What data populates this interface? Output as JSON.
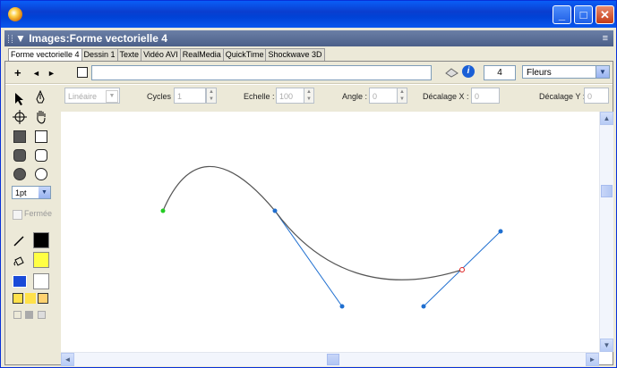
{
  "window": {
    "title": "",
    "minimize": "_",
    "maximize": "□",
    "close": "✕"
  },
  "panel": {
    "title": "▼ Images:Forme vectorielle 4",
    "menu_icon": "≡"
  },
  "tabs": [
    "Forme vectorielle 4",
    "Dessin 1",
    "Texte",
    "Vidéo AVI",
    "RealMedia",
    "QuickTime",
    "Shockwave 3D"
  ],
  "toolbar": {
    "add": "+",
    "prev": "◄",
    "next": "►",
    "name_value": "",
    "number_value": "4",
    "category_value": "Fleurs",
    "category_arrow": "▼"
  },
  "props": {
    "gradient_value": "Linéaire",
    "cycles_label": "Cycles :",
    "cycles_value": "1",
    "scale_label": "Echelle :",
    "scale_value": "100",
    "angle_label": "Angle :",
    "angle_value": "0",
    "offset_x_label": "Décalage X :",
    "offset_x_value": "0",
    "offset_y_label": "Décalage Y :",
    "offset_y_value": "0"
  },
  "tools": {
    "line_width_value": "1pt",
    "closed_label": "Fermée"
  },
  "colors": {
    "titlebar": "#0a5ef7",
    "curve": "#555555",
    "handle": "#1f6fd0",
    "start_point": "#22cc22",
    "fill_color": "#ffff44",
    "stroke_color": "#000000"
  },
  "scroll": {
    "up": "▲",
    "down": "▼",
    "left": "◄",
    "right": "►"
  }
}
